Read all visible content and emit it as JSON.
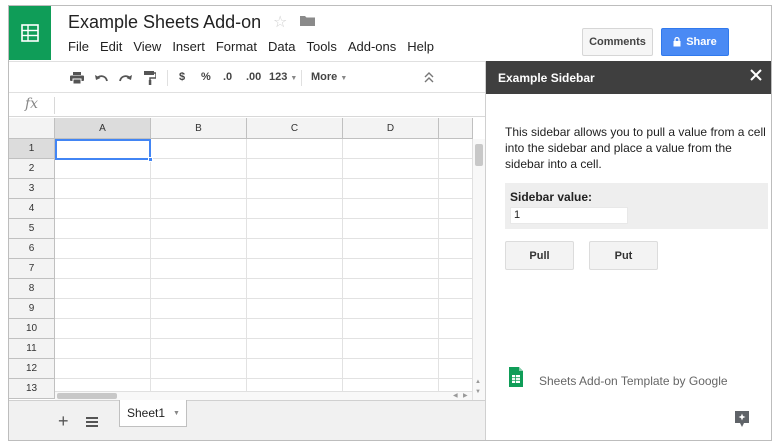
{
  "colors": {
    "brand_green": "#0f9d58",
    "share_blue": "#4a8af4",
    "sidebar_header": "#3f3f3f",
    "selection_blue": "#4285f4"
  },
  "header": {
    "title": "Example Sheets Add-on",
    "menu": [
      "File",
      "Edit",
      "View",
      "Insert",
      "Format",
      "Data",
      "Tools",
      "Add-ons",
      "Help"
    ],
    "comments_label": "Comments",
    "share_label": "Share"
  },
  "toolbar": {
    "currency": "$",
    "percent": "%",
    "dec_decrease": ".0",
    "dec_increase": ".00",
    "number_format": "123",
    "more": "More"
  },
  "formula_bar": {
    "icon": "fx",
    "value": ""
  },
  "grid": {
    "columns": [
      "A",
      "B",
      "C",
      "D"
    ],
    "rows": [
      "1",
      "2",
      "3",
      "4",
      "5",
      "6",
      "7",
      "8",
      "9",
      "10",
      "11",
      "12",
      "13"
    ],
    "active_cell": "A1"
  },
  "sheets": {
    "active": "Sheet1"
  },
  "sidebar": {
    "title": "Example Sidebar",
    "description": "This sidebar allows you to pull a value from a cell into the sidebar and place a value from the sidebar into a cell.",
    "value_label": "Sidebar value:",
    "value": "1",
    "pull_label": "Pull",
    "put_label": "Put",
    "footer_text": "Sheets Add-on Template by Google"
  }
}
